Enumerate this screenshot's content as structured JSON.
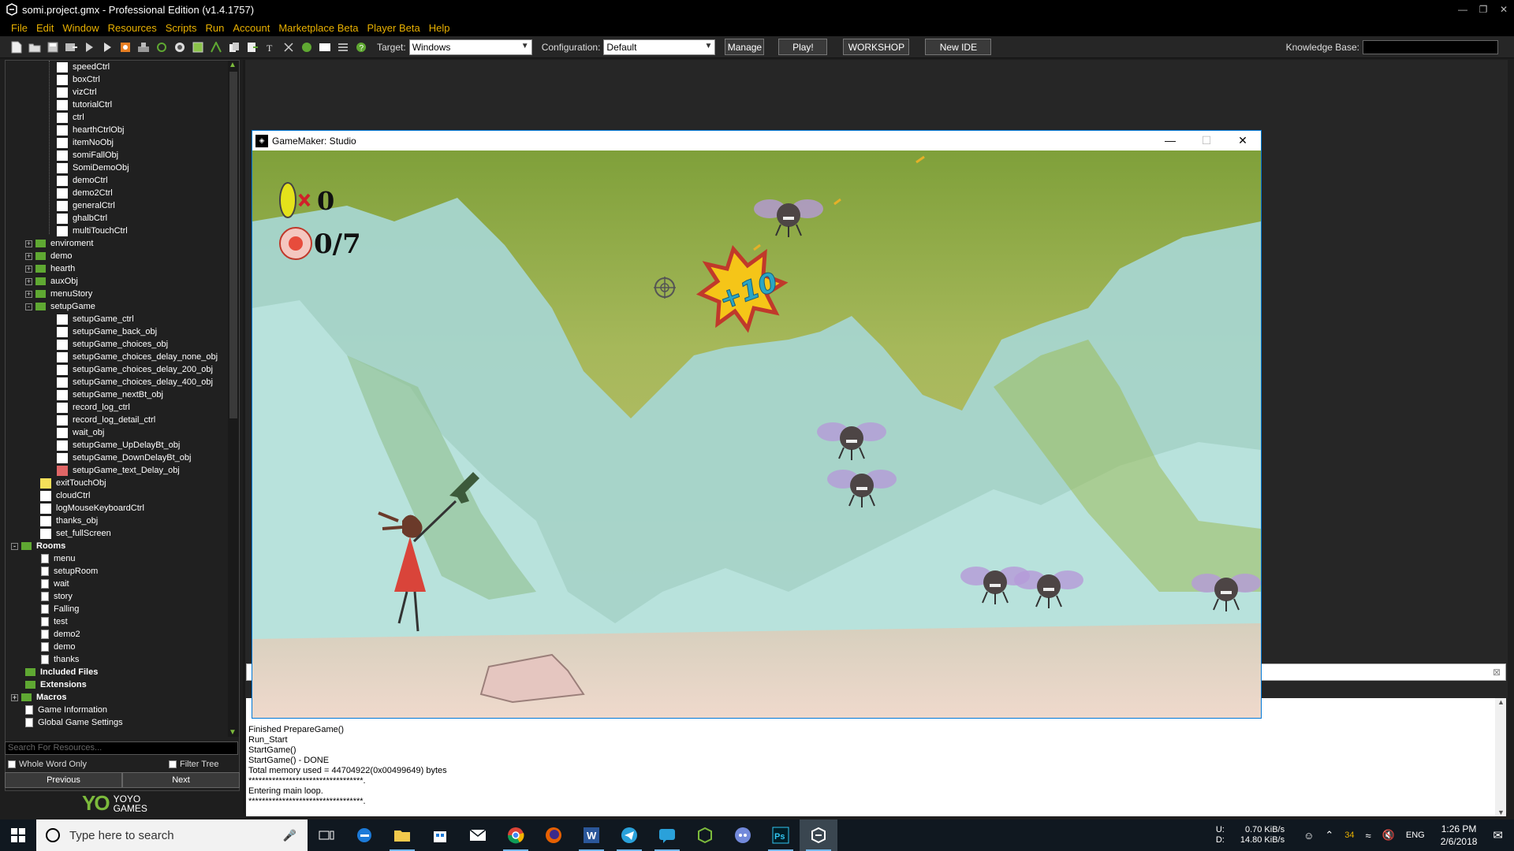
{
  "window": {
    "title": "somi.project.gmx - Professional Edition (v1.4.1757)"
  },
  "menu": [
    "File",
    "Edit",
    "Window",
    "Resources",
    "Scripts",
    "Run",
    "Account",
    "Marketplace Beta",
    "Player Beta",
    "Help"
  ],
  "toolbar": {
    "target_label": "Target:",
    "target_value": "Windows",
    "config_label": "Configuration:",
    "config_value": "Default",
    "manage": "Manage",
    "play": "Play!",
    "workshop": "WORKSHOP",
    "new_ide": "New IDE",
    "kb_label": "Knowledge Base:"
  },
  "tree": {
    "objects_top": [
      "speedCtrl",
      "boxCtrl",
      "vizCtrl",
      "tutorialCtrl",
      "ctrl",
      "hearthCtrlObj",
      "itemNoObj",
      "somiFallObj",
      "SomiDemoObj",
      "demoCtrl",
      "demo2Ctrl",
      "generalCtrl",
      "ghalbCtrl",
      "multiTouchCtrl"
    ],
    "folders": [
      "enviroment",
      "demo",
      "hearth",
      "auxObj",
      "menuStory"
    ],
    "setup_folder": "setupGame",
    "setup_items": [
      "setupGame_ctrl",
      "setupGame_back_obj",
      "setupGame_choices_obj",
      "setupGame_choices_delay_none_obj",
      "setupGame_choices_delay_200_obj",
      "setupGame_choices_delay_400_obj",
      "setupGame_nextBt_obj",
      "record_log_ctrl",
      "record_log_detail_ctrl",
      "wait_obj",
      "setupGame_UpDelayBt_obj",
      "setupGame_DownDelayBt_obj",
      "setupGame_text_Delay_obj"
    ],
    "loose_objects": [
      "exitTouchObj",
      "cloudCtrl",
      "logMouseKeyboardCtrl",
      "thanks_obj",
      "set_fullScreen"
    ],
    "rooms_label": "Rooms",
    "rooms": [
      "menu",
      "setupRoom",
      "wait",
      "story",
      "Falling",
      "test",
      "demo2",
      "demo",
      "thanks"
    ],
    "bottom": [
      "Included Files",
      "Extensions",
      "Macros"
    ],
    "settings": [
      "Game Information",
      "Global Game Settings"
    ],
    "search_placeholder": "Search For Resources...",
    "whole_word": "Whole Word Only",
    "filter_tree": "Filter Tree",
    "previous": "Previous",
    "next": "Next",
    "logo_top": "YOYO",
    "logo_bottom": "GAMES"
  },
  "game_window": {
    "title": "GameMaker: Studio",
    "hud_coins": "0",
    "hud_targets": "0/7",
    "bonus": "+10"
  },
  "output": [
    "Finished PrepareGame()",
    "Run_Start",
    "StartGame()",
    "StartGame() - DONE",
    "Total memory used = 44704922(0x00499649) bytes",
    "**********************************.",
    "Entering main loop.",
    "**********************************."
  ],
  "taskbar": {
    "search_placeholder": "Type here to search",
    "up_label": "U:",
    "down_label": "D:",
    "up_rate": "0.70 KiB/s",
    "down_rate": "14.80 KiB/s",
    "temp": "34",
    "lang": "ENG",
    "time": "1:26 PM",
    "date": "2/6/2018"
  },
  "colors": {
    "menu_text": "#e8b000",
    "folder_green": "#5fa832",
    "accent_blue": "#0078d7"
  }
}
